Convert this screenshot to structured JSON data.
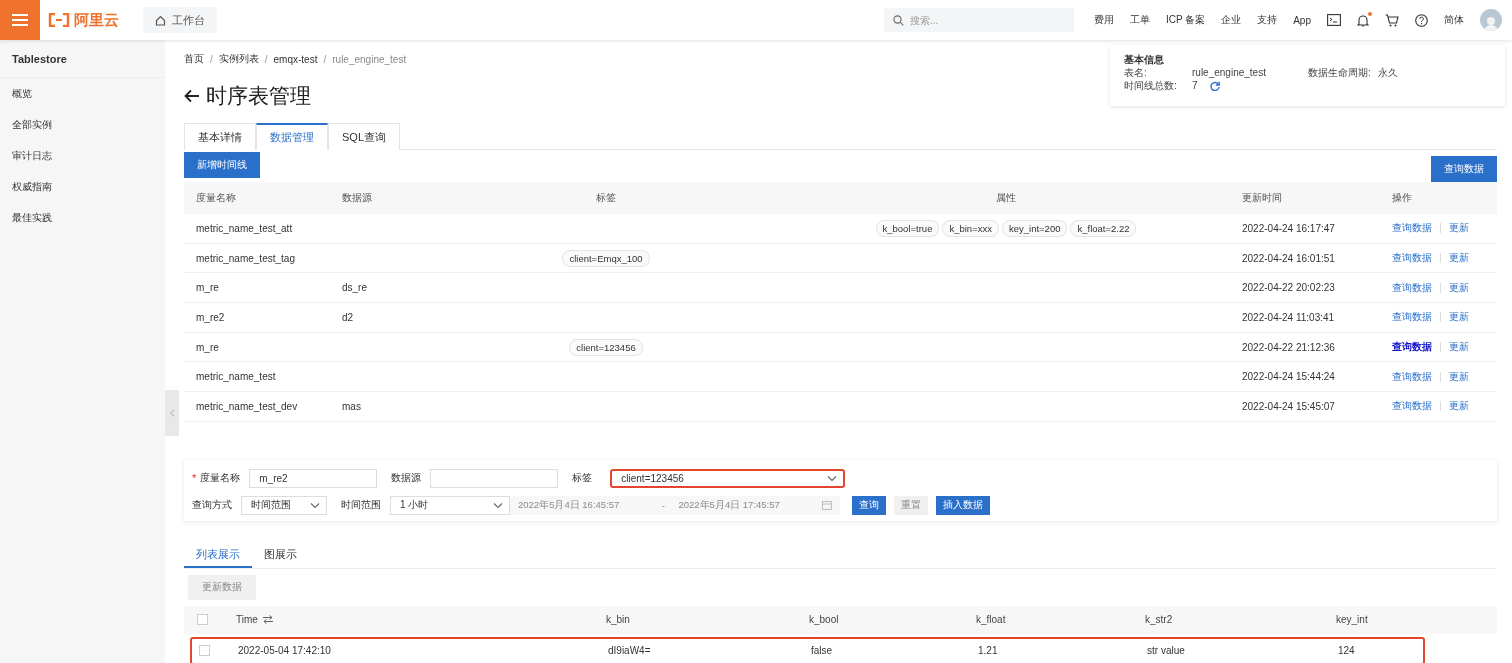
{
  "topbar": {
    "logo": "阿里云",
    "workbench": "工作台",
    "search": {
      "placeholder": "搜索..."
    },
    "nav": [
      "费用",
      "工单",
      "ICP 备案",
      "企业",
      "支持",
      "App"
    ],
    "bell_badge": true,
    "language": "简体"
  },
  "sidebar": {
    "title": "Tablestore",
    "items": [
      "概览",
      "全部实例",
      "审计日志",
      "权威指南",
      "最佳实践"
    ]
  },
  "breadcrumb": [
    {
      "label": "首页",
      "current": false
    },
    {
      "separator": "/",
      "label": "实例列表",
      "current": false
    },
    {
      "separator": "/",
      "label": "emqx-test",
      "current": false
    },
    {
      "separator": "/",
      "label": "rule_engine_test",
      "current": true
    }
  ],
  "title": "时序表管理",
  "info_card": {
    "heading": "基本信息",
    "table_name_label": "表名:",
    "table_name": "rule_engine_test",
    "ttl_label": "数据生命周期:",
    "ttl": "永久",
    "timeline_count_label": "时间线总数:",
    "timeline_count": "7"
  },
  "tabs": [
    {
      "label": "基本详情",
      "selected": false
    },
    {
      "label": "数据管理",
      "selected": true
    },
    {
      "label": "SQL查询",
      "selected": false
    }
  ],
  "add_button": "新增时间线",
  "query_button": "查询数据",
  "table": {
    "columns": [
      "度量名称",
      "数据源",
      "标签",
      "属性",
      "更新时间",
      "操作"
    ],
    "rows": [
      {
        "metric": "metric_name_test_att",
        "attributes": [
          "k_bool=true",
          "k_bin=xxx",
          "key_int=200",
          "k_float=2.22"
        ],
        "updated": "2022-04-24 16:17:47",
        "actions": [
          {
            "label": "查询数据",
            "visited": false
          },
          {
            "label": "更新",
            "visited": false
          }
        ]
      },
      {
        "metric": "metric_name_test_tag",
        "tags": [
          "client=Emqx_100"
        ],
        "updated": "2022-04-24 16:01:51",
        "actions": [
          {
            "label": "查询数据",
            "visited": false
          },
          {
            "label": "更新",
            "visited": false
          }
        ]
      },
      {
        "metric": "m_re",
        "source": "ds_re",
        "updated": "2022-04-22 20:02:23",
        "actions": [
          {
            "label": "查询数据",
            "visited": false
          },
          {
            "label": "更新",
            "visited": false
          }
        ]
      },
      {
        "metric": "m_re2",
        "source": "d2",
        "updated": "2022-04-24 11:03:41",
        "actions": [
          {
            "label": "查询数据",
            "visited": false
          },
          {
            "label": "更新",
            "visited": false
          }
        ]
      },
      {
        "metric": "m_re",
        "tags": [
          "client=123456"
        ],
        "updated": "2022-04-22 21:12:36",
        "actions": [
          {
            "label": "查询数据",
            "visited": true
          },
          {
            "label": "更新",
            "visited": false
          }
        ]
      },
      {
        "metric": "metric_name_test",
        "updated": "2022-04-24 15:44:24",
        "actions": [
          {
            "label": "查询数据",
            "visited": false
          },
          {
            "label": "更新",
            "visited": false
          }
        ]
      },
      {
        "metric": "metric_name_test_dev",
        "source": "mas",
        "updated": "2022-04-24 15:45:07",
        "actions": [
          {
            "label": "查询数据",
            "visited": false
          },
          {
            "label": "更新",
            "visited": false
          }
        ]
      }
    ]
  },
  "query_form": {
    "rows": [
      {
        "items": [
          {
            "kind": "input",
            "required_mark": "*",
            "label": "度量名称",
            "value": "m_re2"
          },
          {
            "kind": "input",
            "label": "数据源"
          },
          {
            "kind": "select",
            "label": "标签",
            "value": "client=123456",
            "highlighted": true
          }
        ]
      },
      {
        "items": [
          {
            "kind": "select",
            "label": "查询方式",
            "value": "时间范围",
            "highlighted": false
          },
          {
            "kind": "select",
            "label": "时间范围",
            "value": "1 小时",
            "highlighted": false
          },
          {
            "kind": "daterange",
            "start": "2022年5月4日 16:45:57",
            "separator": "-",
            "end": "2022年5月4日 17:45:57",
            "disabled": true
          },
          {
            "kind": "button",
            "label": "查询",
            "disabled": false
          },
          {
            "kind": "button",
            "label": "重置",
            "disabled": true
          },
          {
            "kind": "button",
            "label": "插入数据",
            "disabled": false
          }
        ]
      }
    ]
  },
  "view_tabs": [
    {
      "label": "列表展示",
      "selected": true
    },
    {
      "label": "图展示",
      "selected": false
    }
  ],
  "refresh_button": {
    "label": "更新数据",
    "disabled": true
  },
  "result_table": {
    "header_checked": false,
    "columns": [
      "Time",
      "k_bin",
      "k_bool",
      "k_float",
      "k_str2",
      "key_int"
    ],
    "rows": [
      {
        "checked": false,
        "highlighted": true,
        "cells": [
          "2022-05-04 17:42:10",
          "dI9iaW4=",
          "false",
          "1.21",
          "str value",
          "124"
        ]
      }
    ]
  }
}
